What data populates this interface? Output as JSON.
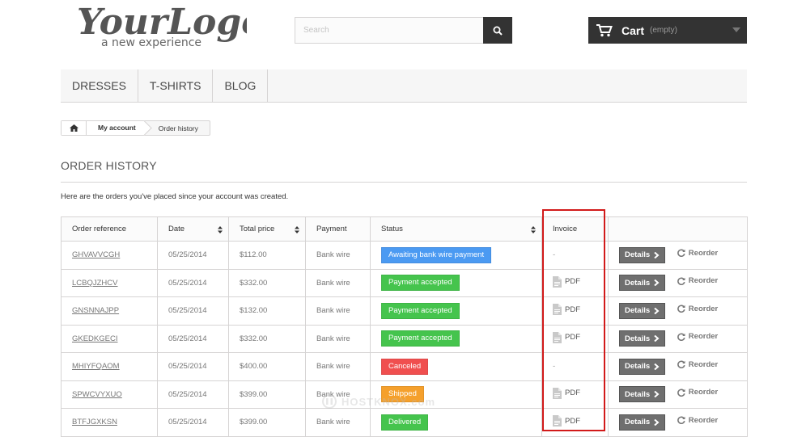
{
  "logo": {
    "line1": "YourLogo",
    "line2": "a new experience"
  },
  "search": {
    "placeholder": "Search",
    "value": ""
  },
  "cart": {
    "label": "Cart",
    "quantity": "(empty)"
  },
  "menu": {
    "items": [
      "Dresses",
      "T-shirts",
      "Blog"
    ]
  },
  "breadcrumb": {
    "my_account": "My account",
    "current": "Order history"
  },
  "page": {
    "title": "ORDER HISTORY",
    "intro": "Here are the orders you've placed since your account was created."
  },
  "table": {
    "headers": [
      "Order reference",
      "Date",
      "Total price",
      "Payment",
      "Status",
      "Invoice",
      ""
    ],
    "rows": [
      {
        "ref": "GHVAVVCGH",
        "date": "05/25/2014",
        "total": "$112.00",
        "payment": "Bank wire",
        "status": "Awaiting bank wire payment",
        "status_color": "#4b9af2",
        "invoice": "-"
      },
      {
        "ref": "LCBQJZHCV",
        "date": "05/25/2014",
        "total": "$332.00",
        "payment": "Bank wire",
        "status": "Payment accepted",
        "status_color": "#45c44d",
        "invoice": "PDF"
      },
      {
        "ref": "GNSNNAJPP",
        "date": "05/25/2014",
        "total": "$132.00",
        "payment": "Bank wire",
        "status": "Payment accepted",
        "status_color": "#45c44d",
        "invoice": "PDF"
      },
      {
        "ref": "GKEDKGECI",
        "date": "05/25/2014",
        "total": "$332.00",
        "payment": "Bank wire",
        "status": "Payment accepted",
        "status_color": "#45c44d",
        "invoice": "PDF"
      },
      {
        "ref": "MHIYFQAOM",
        "date": "05/25/2014",
        "total": "$400.00",
        "payment": "Bank wire",
        "status": "Canceled",
        "status_color": "#f04f4f",
        "invoice": "-"
      },
      {
        "ref": "SPWCVYXUO",
        "date": "05/25/2014",
        "total": "$399.00",
        "payment": "Bank wire",
        "status": "Shipped",
        "status_color": "#f5a02c",
        "invoice": "PDF"
      },
      {
        "ref": "BTFJGXKSN",
        "date": "05/25/2014",
        "total": "$399.00",
        "payment": "Bank wire",
        "status": "Delivered",
        "status_color": "#45c44d",
        "invoice": "PDF"
      }
    ],
    "details_label": "Details",
    "reorder_label": "Reorder"
  },
  "watermark": "HOSTKNOX.com",
  "colors": {
    "highlight": "#d21a1a",
    "dark": "#333333"
  }
}
